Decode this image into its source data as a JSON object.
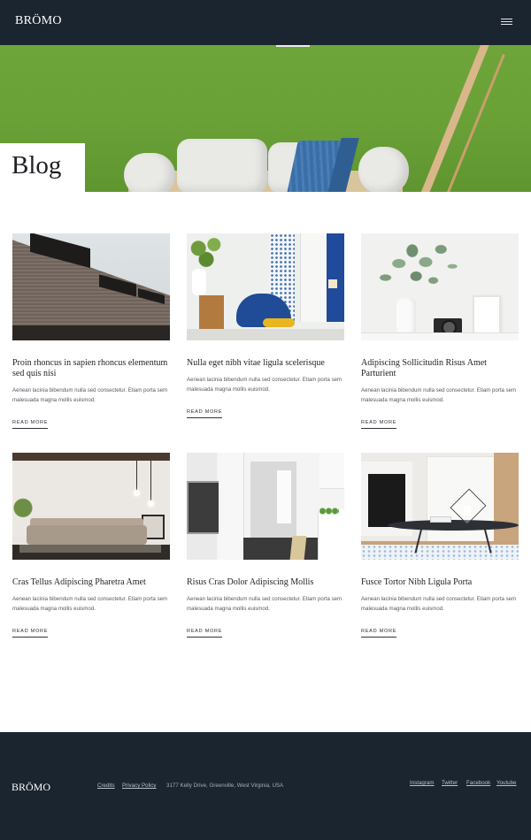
{
  "brand": "BRÖMO",
  "header": {
    "menu_icon": "hamburger-menu-icon"
  },
  "hero": {
    "title": "Blog"
  },
  "posts": [
    {
      "title": "Proin rhoncus in sapien rhoncus elementum sed quis nisi",
      "excerpt": "Aenean lacinia bibendum nulla sed consectetur. Etiam porta sem malesuada magna mollis euismod.",
      "cta": "READ MORE"
    },
    {
      "title": "Nulla eget nibh vitae ligula scelerisque",
      "excerpt": "Aenean lacinia bibendum nulla sed consectetur. Etiam porta sem malesuada magna mollis euismod.",
      "cta": "READ MORE"
    },
    {
      "title": "Adipiscing Sollicitudin Risus Amet Parturient",
      "excerpt": "Aenean lacinia bibendum nulla sed consectetur. Etiam porta sem malesuada magna mollis euismod.",
      "cta": "READ MORE"
    },
    {
      "title": "Cras Tellus Adipiscing Pharetra Amet",
      "excerpt": "Aenean lacinia bibendum nulla sed consectetur. Etiam porta sem malesuada magna mollis euismod.",
      "cta": "READ MORE"
    },
    {
      "title": "Risus Cras Dolor Adipiscing Mollis",
      "excerpt": "Aenean lacinia bibendum nulla sed consectetur. Etiam porta sem malesuada magna mollis euismod.",
      "cta": "READ MORE"
    },
    {
      "title": "Fusce Tortor Nibh Ligula Porta",
      "excerpt": "Aenean lacinia bibendum nulla sed consectetur. Etiam porta sem malesuada magna mollis euismod.",
      "cta": "READ MORE"
    }
  ],
  "footer": {
    "brand": "BRÖMO",
    "links": [
      "Credits",
      "Privacy Policy"
    ],
    "address": "3177 Kelly Drive, Greenville, West Virginia, USA",
    "social": [
      "Instagram",
      "Twitter",
      "Facebook",
      "Youtube"
    ]
  },
  "colors": {
    "header_bg": "#1b2530",
    "footer_bg": "#1b2530",
    "hero_green": "#6aa137",
    "text_dark": "#1e2024"
  }
}
